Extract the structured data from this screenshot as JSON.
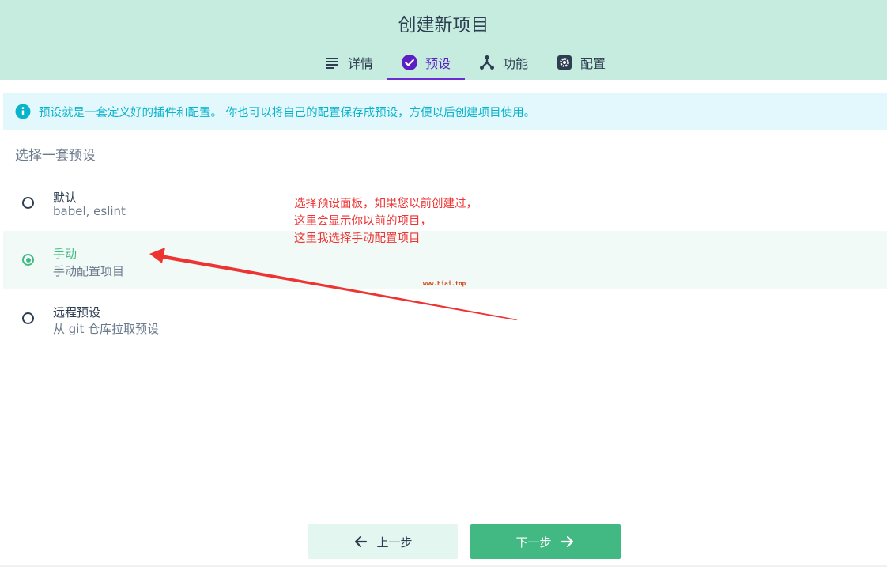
{
  "header": {
    "title": "创建新项目",
    "tabs": [
      {
        "label": "详情",
        "icon": "list-icon",
        "active": false
      },
      {
        "label": "预设",
        "icon": "check-circle-icon",
        "active": true
      },
      {
        "label": "功能",
        "icon": "fork-icon",
        "active": false
      },
      {
        "label": "配置",
        "icon": "gear-icon",
        "active": false
      }
    ]
  },
  "info": {
    "icon": "info-icon",
    "text": "预设就是一套定义好的插件和配置。 你也可以将自己的配置保存成预设，方便以后创建项目使用。"
  },
  "section_title": "选择一套预设",
  "presets": [
    {
      "name": "默认",
      "description": "babel, eslint",
      "selected": false
    },
    {
      "name": "手动",
      "description": "手动配置项目",
      "selected": true
    },
    {
      "name": "远程预设",
      "description": "从 git 仓库拉取预设",
      "selected": false
    }
  ],
  "annotation": {
    "lines": [
      "选择预设面板，如果您以前创建过，",
      "这里会显示你以前的项目，",
      "这里我选择手动配置项目"
    ],
    "color": "#ee3333"
  },
  "watermark": "www.hiai.top",
  "footer": {
    "prev_label": "上一步",
    "next_label": "下一步"
  },
  "colors": {
    "header_bg": "#c6ebdf",
    "accent_green": "#42b983",
    "accent_purple": "#6a2fd0",
    "info_text": "#08b4cc",
    "info_bg": "#e3f8fc"
  }
}
